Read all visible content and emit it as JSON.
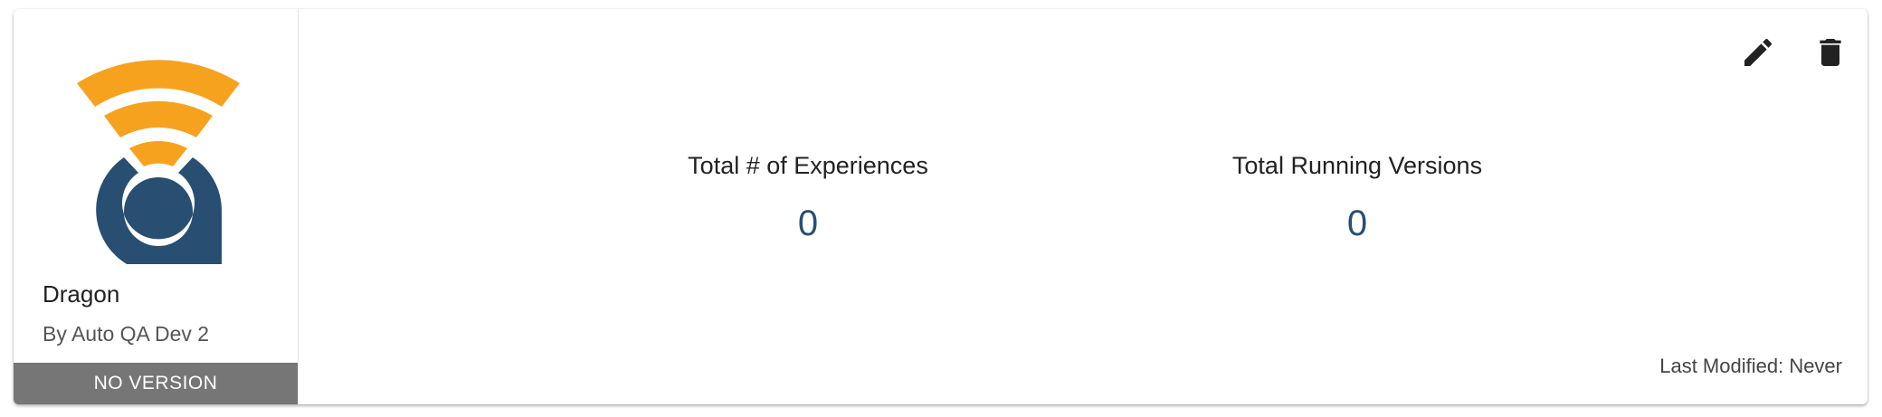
{
  "card": {
    "app_name": "Dragon",
    "author": "By Auto QA Dev 2",
    "version_badge": "NO VERSION",
    "logo_icon": "wifi-pin-logo-icon",
    "actions": {
      "edit_icon": "pencil-icon",
      "delete_icon": "trash-icon"
    },
    "stats": [
      {
        "label": "Total # of Experiences",
        "value": "0"
      },
      {
        "label": "Total Running Versions",
        "value": "0"
      }
    ],
    "last_modified": {
      "label": "Last Modified:",
      "value": "Never"
    }
  },
  "colors": {
    "logo_orange": "#f7a21f",
    "logo_navy": "#284f72",
    "badge_gray": "#767676",
    "stat_value": "#284f72",
    "icon_dark": "#222222"
  }
}
